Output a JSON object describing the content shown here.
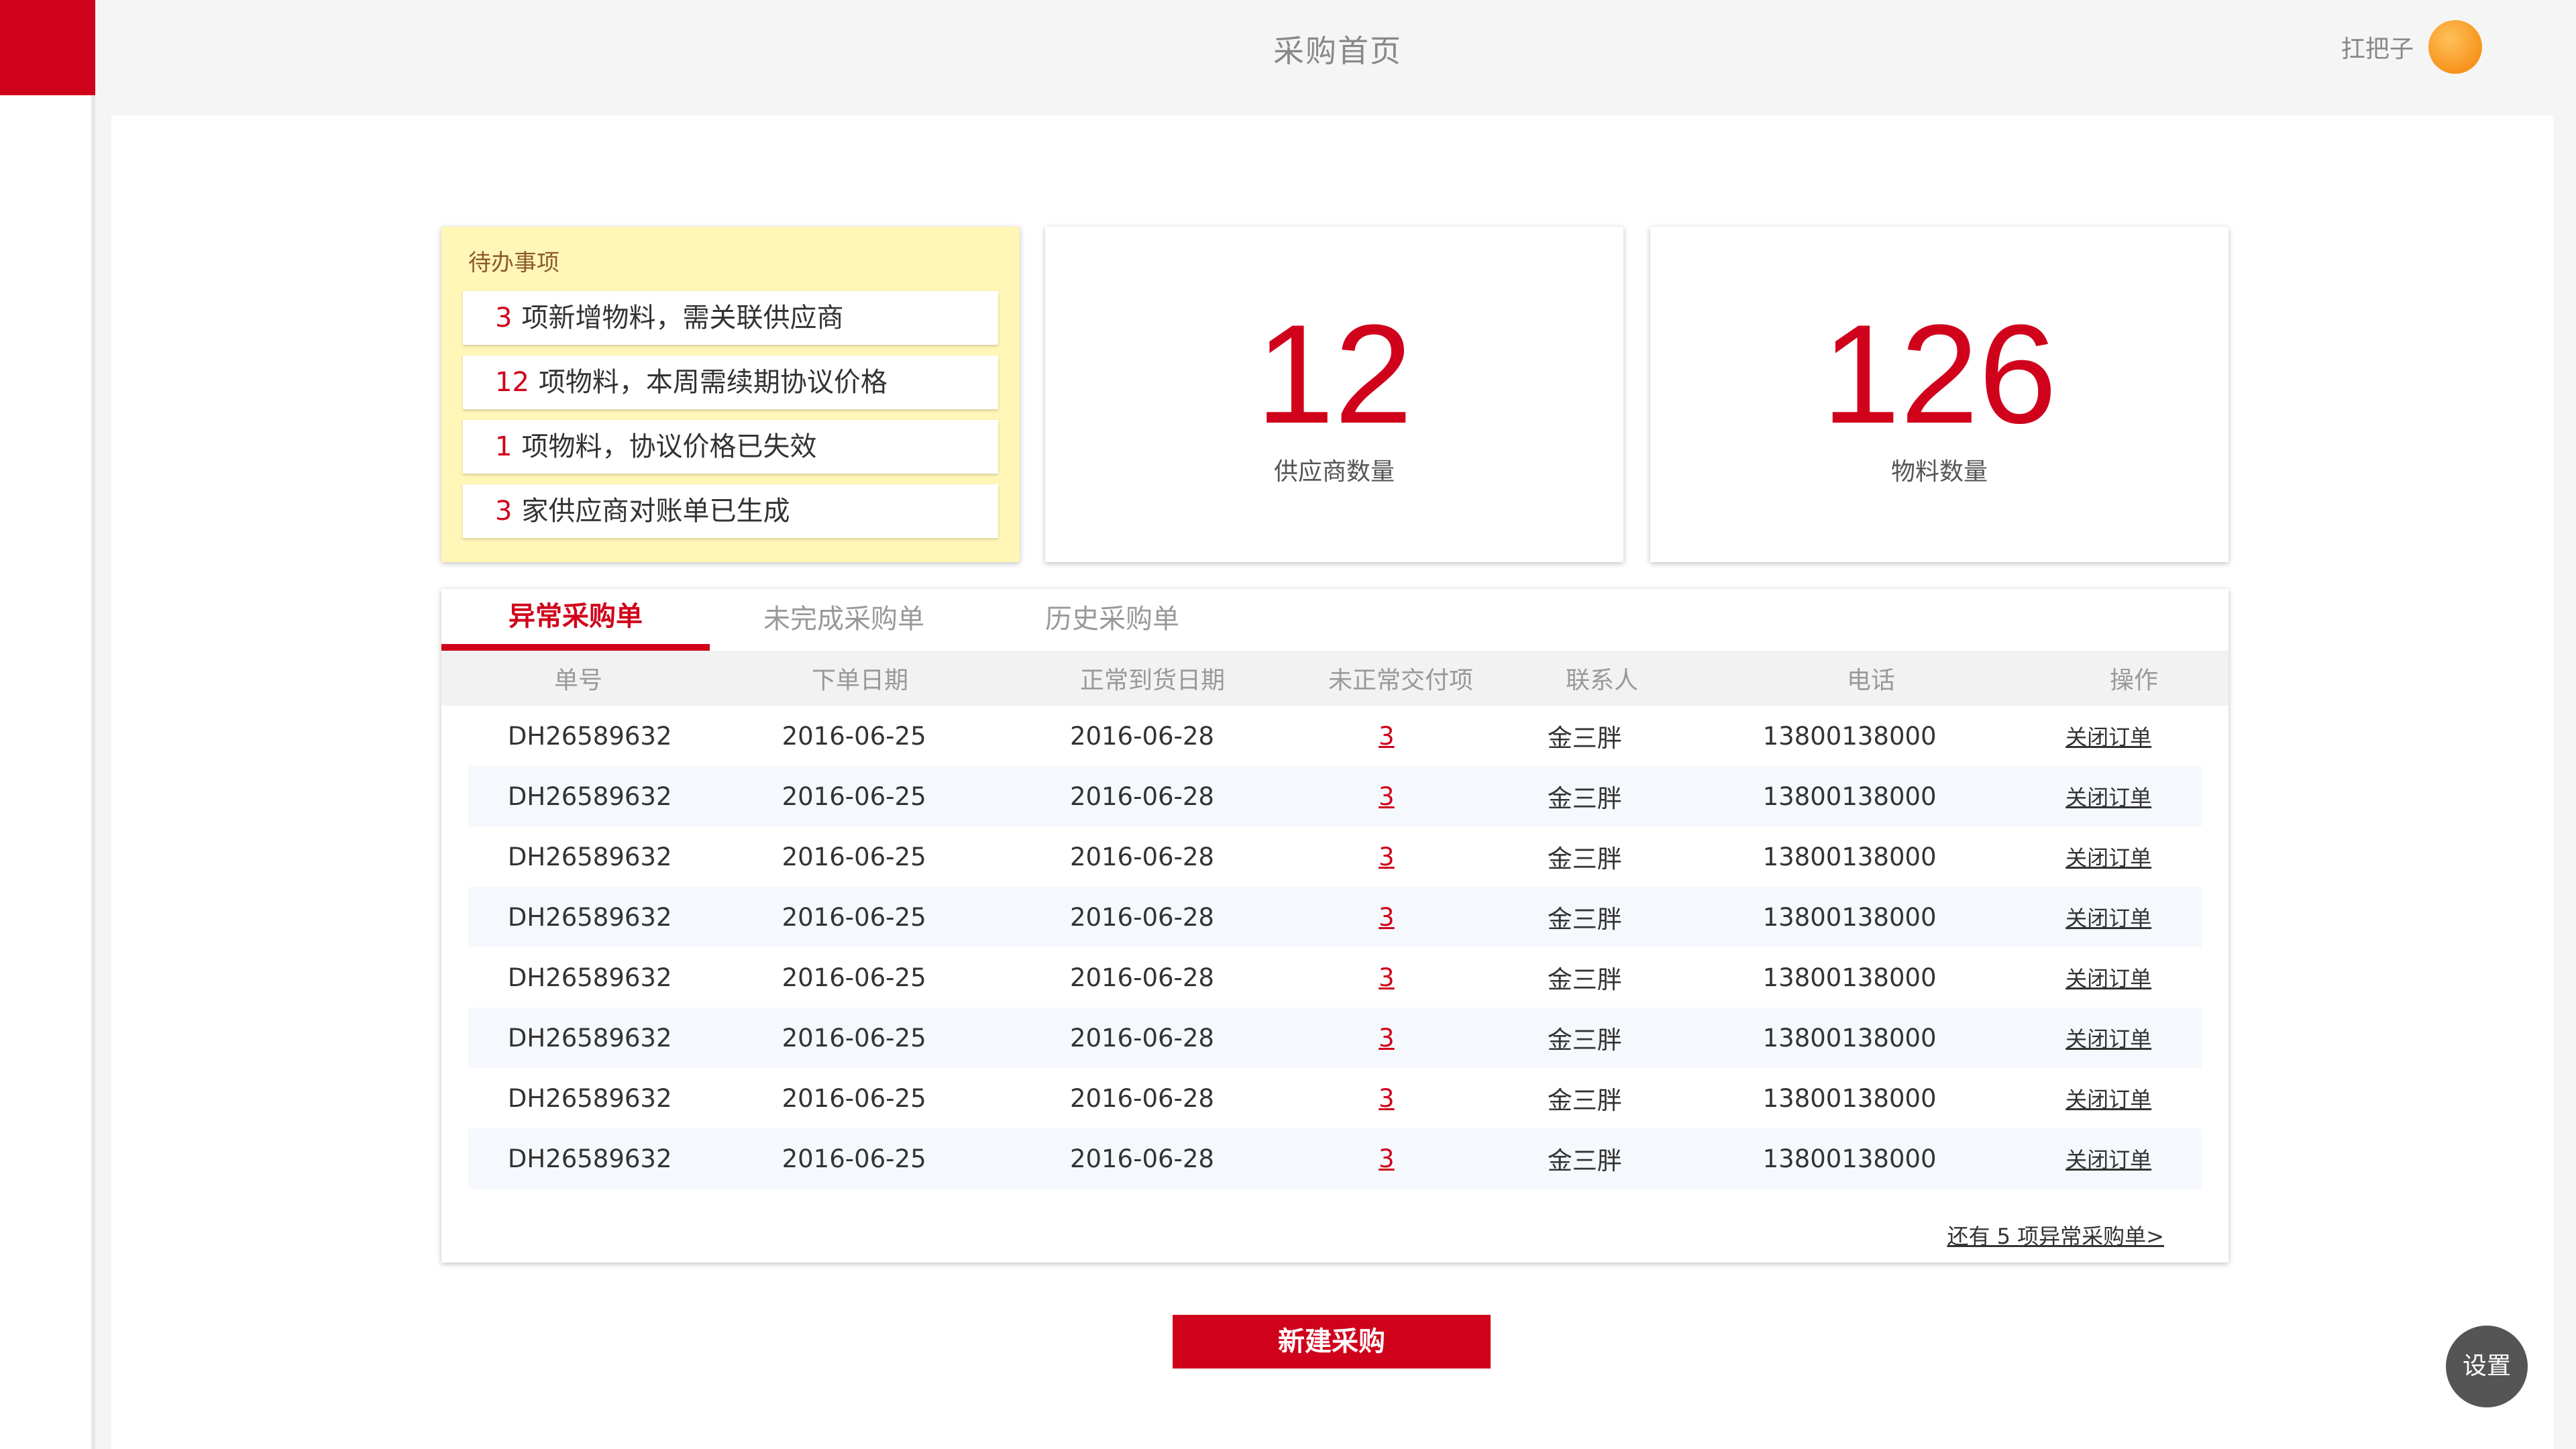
{
  "header": {
    "title": "采购首页",
    "user_name": "扛把子"
  },
  "todo": {
    "title": "待办事项",
    "items": [
      {
        "count": "3",
        "text": "项新增物料，需关联供应商"
      },
      {
        "count": "12",
        "text": "项物料，本周需续期协议价格"
      },
      {
        "count": "1",
        "text": "项物料，协议价格已失效"
      },
      {
        "count": "3",
        "text": "家供应商对账单已生成"
      }
    ]
  },
  "stats": [
    {
      "value": "12",
      "label": "供应商数量"
    },
    {
      "value": "126",
      "label": "物料数量"
    }
  ],
  "tabs": [
    {
      "label": "异常采购单"
    },
    {
      "label": "未完成采购单"
    },
    {
      "label": "历史采购单"
    }
  ],
  "table": {
    "columns": [
      "单号",
      "下单日期",
      "正常到货日期",
      "未正常交付项",
      "联系人",
      "电话",
      "操作"
    ],
    "rows": [
      [
        "DH26589632",
        "2016-06-25",
        "2016-06-28",
        "3",
        "金三胖",
        "13800138000",
        "关闭订单"
      ],
      [
        "DH26589632",
        "2016-06-25",
        "2016-06-28",
        "3",
        "金三胖",
        "13800138000",
        "关闭订单"
      ],
      [
        "DH26589632",
        "2016-06-25",
        "2016-06-28",
        "3",
        "金三胖",
        "13800138000",
        "关闭订单"
      ],
      [
        "DH26589632",
        "2016-06-25",
        "2016-06-28",
        "3",
        "金三胖",
        "13800138000",
        "关闭订单"
      ],
      [
        "DH26589632",
        "2016-06-25",
        "2016-06-28",
        "3",
        "金三胖",
        "13800138000",
        "关闭订单"
      ],
      [
        "DH26589632",
        "2016-06-25",
        "2016-06-28",
        "3",
        "金三胖",
        "13800138000",
        "关闭订单"
      ],
      [
        "DH26589632",
        "2016-06-25",
        "2016-06-28",
        "3",
        "金三胖",
        "13800138000",
        "关闭订单"
      ],
      [
        "DH26589632",
        "2016-06-25",
        "2016-06-28",
        "3",
        "金三胖",
        "13800138000",
        "关闭订单"
      ]
    ],
    "more_link": "还有 5 项异常采购单>"
  },
  "buttons": {
    "new_purchase": "新建采购",
    "settings": "设置"
  },
  "colors": {
    "accent": "#d0021b",
    "todo_bg": "#fff6b8",
    "avatar": "#f7941d"
  }
}
